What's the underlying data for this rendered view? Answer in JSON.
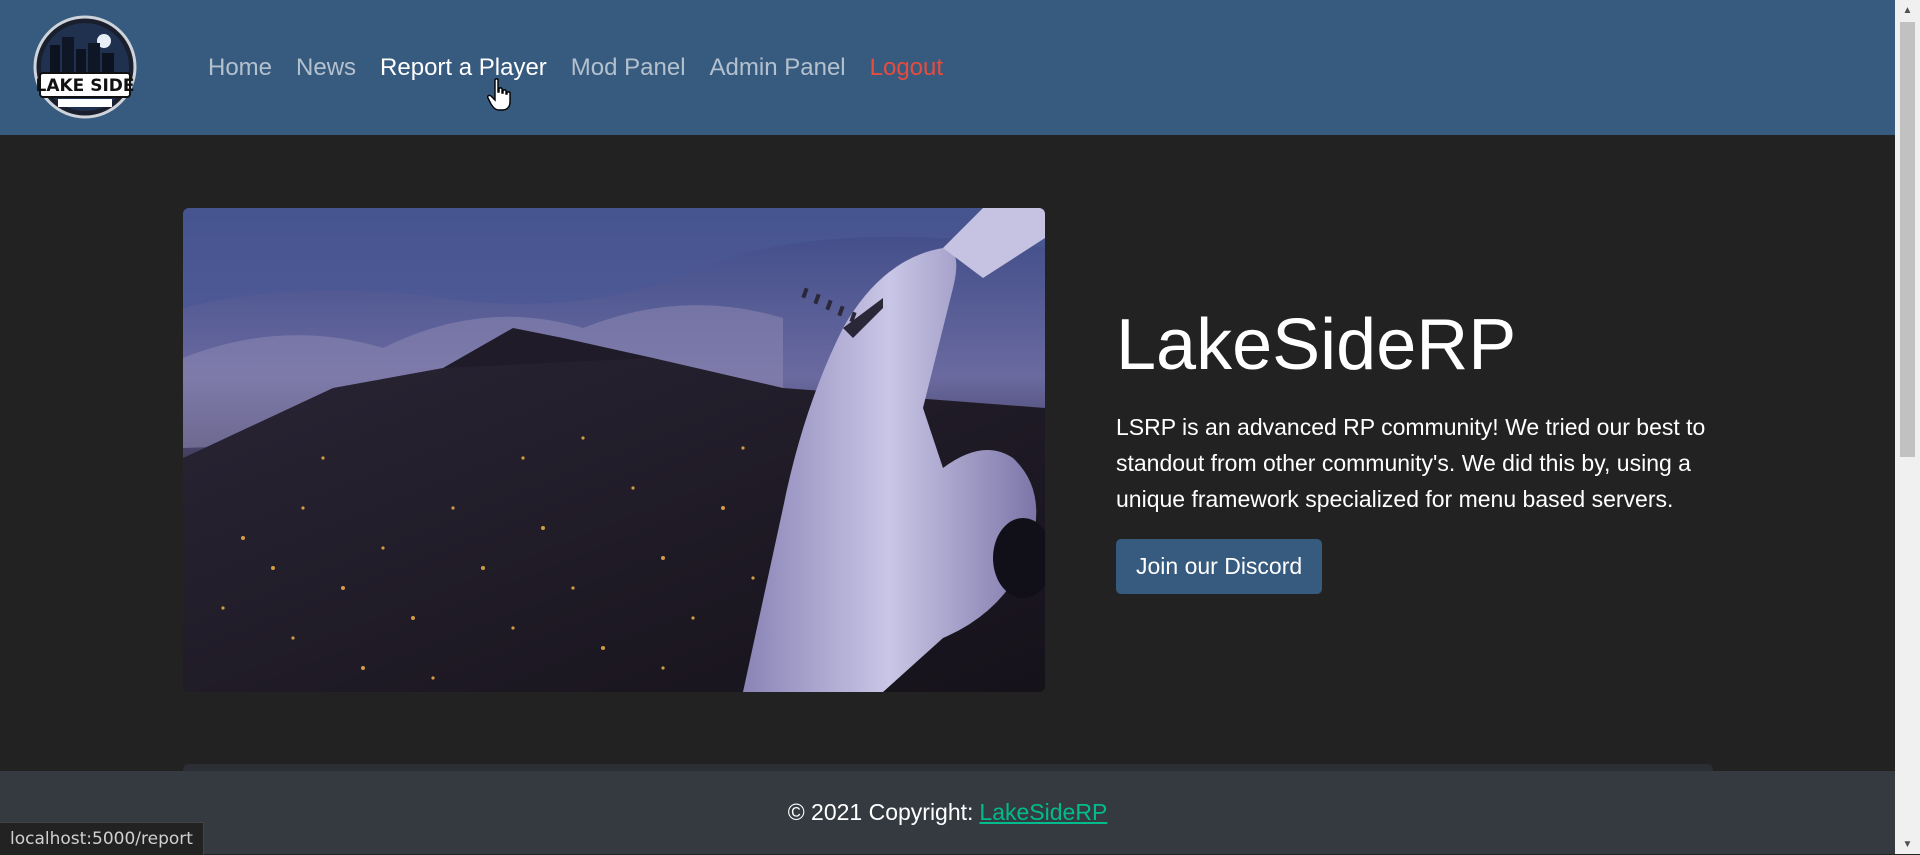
{
  "navbar": {
    "logo_alt": "LAKE SIDE",
    "links": [
      {
        "label": "Home"
      },
      {
        "label": "News"
      },
      {
        "label": "Report a Player"
      },
      {
        "label": "Mod Panel"
      },
      {
        "label": "Admin Panel"
      },
      {
        "label": "Logout"
      }
    ]
  },
  "hero": {
    "title": "LakeSideRP",
    "description": "LSRP is an advanced RP community! We tried our best to standout from other community's. We did this by, using a unique framework specialized for menu based servers.",
    "button_label": "Join our Discord"
  },
  "footer": {
    "copyright": "© 2021 Copyright:",
    "link_label": "LakeSideRP"
  },
  "status_bar": {
    "url": "localhost:5000/report"
  },
  "colors": {
    "navbar_bg": "#375a7f",
    "page_bg": "#222222",
    "footer_bg": "#343a40",
    "logout": "#e74c3c",
    "footer_link": "#00bc8c"
  }
}
